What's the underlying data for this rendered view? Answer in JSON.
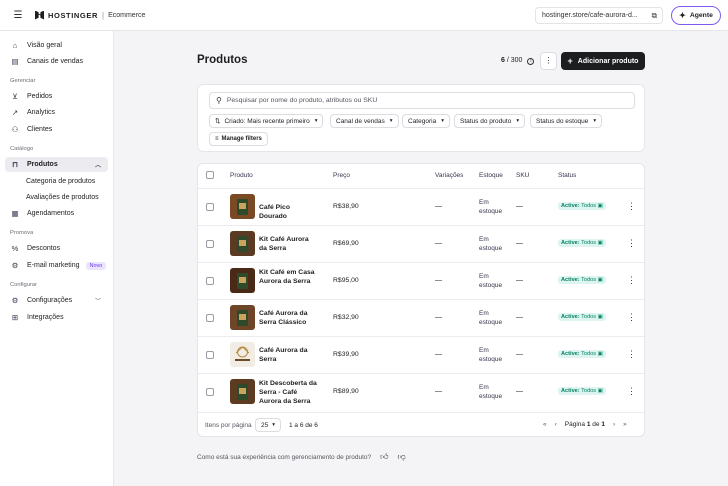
{
  "topbar": {
    "brand": "HOSTINGER",
    "section": "Ecommerce",
    "url": "hostinger.store/cafe-aurora-d...",
    "agent_label": "Agente"
  },
  "sidebar": {
    "items_top": [
      {
        "label": "Visão geral",
        "icon": "home-icon"
      },
      {
        "label": "Canais de vendas",
        "icon": "store-icon"
      }
    ],
    "head_gerenciar": "Gerenciar",
    "items_gerenciar": [
      {
        "label": "Pedidos",
        "icon": "cart-icon"
      },
      {
        "label": "Analytics",
        "icon": "chart-icon"
      },
      {
        "label": "Clientes",
        "icon": "users-icon"
      }
    ],
    "head_catalogo": "Catálogo",
    "produtos_label": "Produtos",
    "subitems": [
      "Categoria de produtos",
      "Avaliações de produtos"
    ],
    "agendamentos": "Agendamentos",
    "head_promova": "Promova",
    "descontos": "Descontos",
    "email_marketing": "E-mail marketing",
    "novo_badge": "Novo",
    "head_configurar": "Configurar",
    "configuracoes": "Configurações",
    "integracoes": "Integrações"
  },
  "main": {
    "title": "Produtos",
    "count_current": "6",
    "count_total": "/ 300",
    "add_button": "Adicionar produto",
    "search_placeholder": "Pesquisar por nome do produto, atributos ou SKU",
    "chips": [
      "Criado: Mais recente primeiro",
      "Canal de vendas",
      "Categoria",
      "Status do produto",
      "Status do estoque"
    ],
    "manage_filters": "Manage filters"
  },
  "table": {
    "headers": {
      "produto": "Produto",
      "preco": "Preço",
      "variacoes": "Variações",
      "estoque": "Estoque",
      "sku": "SKU",
      "status": "Status"
    },
    "rows": [
      {
        "name": "Café Pico Dourado",
        "price": "R$38,90",
        "variations": "—",
        "stock": "Em estoque",
        "sku": "—",
        "status_active": "Active:",
        "status_channel": "Todos",
        "thumb_color": "#7a4a24"
      },
      {
        "name": "Kit Café Aurora da Serra",
        "price": "R$69,90",
        "variations": "—",
        "stock": "Em estoque",
        "sku": "—",
        "status_active": "Active:",
        "status_channel": "Todos",
        "thumb_color": "#5a3a22"
      },
      {
        "name": "Kit Café em Casa Aurora da Serra",
        "price": "R$95,00",
        "variations": "—",
        "stock": "Em estoque",
        "sku": "—",
        "status_active": "Active:",
        "status_channel": "Todos",
        "thumb_color": "#4a2a16"
      },
      {
        "name": "Café Aurora da Serra Clássico",
        "price": "R$32,90",
        "variations": "—",
        "stock": "Em estoque",
        "sku": "—",
        "status_active": "Active:",
        "status_channel": "Todos",
        "thumb_color": "#6e4526"
      },
      {
        "name": "Café Aurora da Serra",
        "price": "R$39,90",
        "variations": "—",
        "stock": "Em estoque",
        "sku": "—",
        "status_active": "Active:",
        "status_channel": "Todos",
        "thumb_color": "#f2ede4"
      },
      {
        "name": "Kit Descoberta da Serra - Café Aurora da Serra",
        "price": "R$89,90",
        "variations": "—",
        "stock": "Em estoque",
        "sku": "—",
        "status_active": "Active:",
        "status_channel": "Todos",
        "thumb_color": "#5c3b20"
      }
    ],
    "footer": {
      "items_per_page_label": "Itens por página",
      "items_per_page": "25",
      "range": "1 a 6 de 6",
      "page_prefix": "Página",
      "page_current": "1",
      "page_of": "de",
      "page_total": "1"
    }
  },
  "feedback": "Como está sua experiência com gerenciamento de produto?"
}
